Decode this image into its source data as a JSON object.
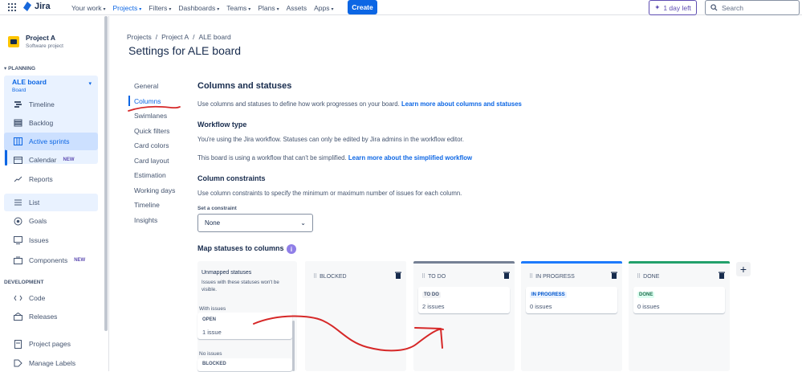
{
  "topbar": {
    "logo": "Jira",
    "nav": [
      {
        "label": "Your work",
        "active": false
      },
      {
        "label": "Projects",
        "active": true
      },
      {
        "label": "Filters",
        "active": false
      },
      {
        "label": "Dashboards",
        "active": false
      },
      {
        "label": "Teams",
        "active": false
      },
      {
        "label": "Plans",
        "active": false
      },
      {
        "label": "Assets",
        "active": false,
        "no_caret": true
      },
      {
        "label": "Apps",
        "active": false
      }
    ],
    "create_label": "Create",
    "trial_label": "1 day left",
    "search_placeholder": "Search"
  },
  "sidebar": {
    "project_name": "Project A",
    "project_type": "Software project",
    "planning_label": "PLANNING",
    "board_name": "ALE board",
    "board_type": "Board",
    "planning_items": [
      {
        "label": "Timeline",
        "icon": "timeline-icon"
      },
      {
        "label": "Backlog",
        "icon": "backlog-icon"
      },
      {
        "label": "Active sprints",
        "icon": "board-icon",
        "active": true
      },
      {
        "label": "Calendar",
        "icon": "calendar-icon",
        "badge": "NEW"
      },
      {
        "label": "Reports",
        "icon": "reports-icon"
      }
    ],
    "other_items": [
      {
        "label": "List",
        "icon": "list-icon"
      },
      {
        "label": "Goals",
        "icon": "goals-icon"
      },
      {
        "label": "Issues",
        "icon": "issues-icon"
      },
      {
        "label": "Components",
        "icon": "components-icon",
        "badge": "NEW"
      }
    ],
    "development_label": "DEVELOPMENT",
    "dev_items": [
      {
        "label": "Code",
        "icon": "code-icon"
      },
      {
        "label": "Releases",
        "icon": "releases-icon"
      }
    ],
    "bottom_items": [
      {
        "label": "Project pages",
        "icon": "pages-icon"
      },
      {
        "label": "Manage Labels",
        "icon": "labels-icon"
      }
    ]
  },
  "breadcrumbs": [
    "Projects",
    "/",
    "Project A",
    "/",
    "ALE board"
  ],
  "page_title": "Settings for ALE board",
  "settings_nav": [
    "General",
    "Columns",
    "Swimlanes",
    "Quick filters",
    "Card colors",
    "Card layout",
    "Estimation",
    "Working days",
    "Timeline",
    "Insights"
  ],
  "settings_active": "Columns",
  "content": {
    "heading": "Columns and statuses",
    "intro": "Use columns and statuses to define how work progresses on your board. ",
    "intro_link": "Learn more about columns and statuses",
    "workflow_heading": "Workflow type",
    "workflow_text": "You're using the Jira workflow. Statuses can only be edited by Jira admins in the workflow editor.",
    "workflow_text2": "This board is using a workflow that can't be simplified. ",
    "workflow_link": "Learn more about the simplified workflow",
    "constraints_heading": "Column constraints",
    "constraints_text": "Use column constraints to specify the minimum or maximum number of issues for each column.",
    "constraint_label": "Set a constraint",
    "constraint_value": "None",
    "map_heading": "Map statuses to columns",
    "info_icon": "i"
  },
  "unmapped": {
    "title": "Unmapped statuses",
    "description": "Issues with these statuses won't be visible.",
    "with_issues_label": "With issues",
    "open_status": "OPEN",
    "open_count": "1 issue",
    "no_issues_label": "No issues",
    "blocked_status": "BLOCKED"
  },
  "columns": [
    {
      "name": "BLOCKED",
      "accent": "#f7f8f9",
      "card": null
    },
    {
      "name": "TO DO",
      "accent": "#758195",
      "card": {
        "status": "TO DO",
        "count": "2 issues",
        "bg": "#f1f2f4",
        "fg": "#44546f"
      }
    },
    {
      "name": "IN PROGRESS",
      "accent": "#1d7afc",
      "card": {
        "status": "IN PROGRESS",
        "count": "0 issues",
        "bg": "#e9f2ff",
        "fg": "#0055cc"
      }
    },
    {
      "name": "DONE",
      "accent": "#22a06b",
      "card": {
        "status": "DONE",
        "count": "0 issues",
        "bg": "#dcfff1",
        "fg": "#216e4e"
      }
    }
  ],
  "annotation_color": "#d62828"
}
